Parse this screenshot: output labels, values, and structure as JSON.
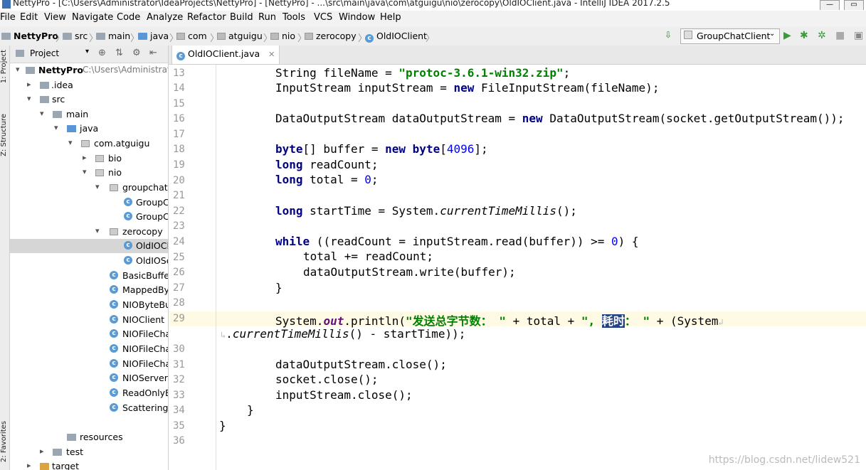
{
  "window": {
    "title": "NettyPro - [C:\\Users\\Administrator\\IdeaProjects\\NettyPro] - [NettyPro] - ...\\src\\main\\java\\com\\atguigu\\nio\\zerocopy\\OldIOClient.java - IntelliJ IDEA 2017.2.5"
  },
  "menu": [
    "File",
    "Edit",
    "View",
    "Navigate",
    "Code",
    "Analyze",
    "Refactor",
    "Build",
    "Run",
    "Tools",
    "VCS",
    "Window",
    "Help"
  ],
  "breadcrumb": [
    "NettyPro",
    "src",
    "main",
    "java",
    "com",
    "atguigu",
    "nio",
    "zerocopy",
    "OldIOClient"
  ],
  "run_config": "GroupChatClient",
  "side_tabs": {
    "project": "1: Project",
    "structure": "Z: Structure",
    "favorites": "2: Favorites"
  },
  "project_panel": {
    "title": "Project",
    "tree": [
      {
        "label": "NettyPro",
        "hint": "C:\\Users\\Administrator"
      },
      {
        "label": ".idea"
      },
      {
        "label": "src"
      },
      {
        "label": "main"
      },
      {
        "label": "java"
      },
      {
        "label": "com.atguigu"
      },
      {
        "label": "bio"
      },
      {
        "label": "nio"
      },
      {
        "label": "groupchat"
      },
      {
        "label": "GroupC"
      },
      {
        "label": "GroupC"
      },
      {
        "label": "zerocopy"
      },
      {
        "label": "OldIOClient"
      },
      {
        "label": "OldIOSe"
      },
      {
        "label": "BasicBuffer"
      },
      {
        "label": "MappedBy"
      },
      {
        "label": "NIOByteBu"
      },
      {
        "label": "NIOClient"
      },
      {
        "label": "NIOFileCha"
      },
      {
        "label": "NIOFileCha"
      },
      {
        "label": "NIOFileCha"
      },
      {
        "label": "NIOServer"
      },
      {
        "label": "ReadOnlyB"
      },
      {
        "label": "ScatteringA"
      },
      {
        "label": "resources"
      },
      {
        "label": "test"
      },
      {
        "label": "target"
      }
    ]
  },
  "editor": {
    "tab": "OldIOClient.java",
    "line_numbers": [
      "13",
      "14",
      "15",
      "16",
      "17",
      "18",
      "19",
      "20",
      "21",
      "22",
      "23",
      "24",
      "25",
      "26",
      "27",
      "28",
      "29",
      "30",
      "31",
      "32",
      "33",
      "34",
      "35",
      "36"
    ],
    "code": {
      "l13a": "String fileName = ",
      "l13b": "\"protoc-3.6.1-win32.zip\"",
      "l13c": ";",
      "l14a": "InputStream inputStream = ",
      "l14b": "new",
      "l14c": " FileInputStream(fileName);",
      "l16a": "DataOutputStream dataOutputStream = ",
      "l16b": "new",
      "l16c": " DataOutputStream(socket.getOutputStream());",
      "l18a": "byte",
      "l18b": "[] buffer = ",
      "l18c": "new",
      "l18d": " ",
      "l18e": "byte",
      "l18f": "[",
      "l18g": "4096",
      "l18h": "];",
      "l19a": "long",
      "l19b": " readCount;",
      "l20a": "long",
      "l20b": " total = ",
      "l20c": "0",
      "l20d": ";",
      "l22a": "long",
      "l22b": " startTime = System.",
      "l22c": "currentTimeMillis",
      "l22d": "();",
      "l24a": "while",
      "l24b": " ((readCount = inputStream.read(buffer)) >= ",
      "l24c": "0",
      "l24d": ") {",
      "l25": "total += readCount;",
      "l26": "dataOutputStream.write(buffer);",
      "l27": "}",
      "l29a": "System.",
      "l29b": "out",
      "l29c": ".println(",
      "l29d": "\"发送总字节数： \"",
      "l29e": " + total + ",
      "l29f": "\", ",
      "l29g": "耗时",
      "l29h": "： \"",
      "l29i": " + (System",
      "l29w1": ".",
      "l29w2": "currentTimeMillis",
      "l29w3": "() - startTime));",
      "l31": "dataOutputStream.close();",
      "l32": "socket.close();",
      "l33": "inputStream.close();",
      "l34": "}",
      "l35": "}"
    }
  },
  "watermark": "https://blog.csdn.net/lidew521"
}
